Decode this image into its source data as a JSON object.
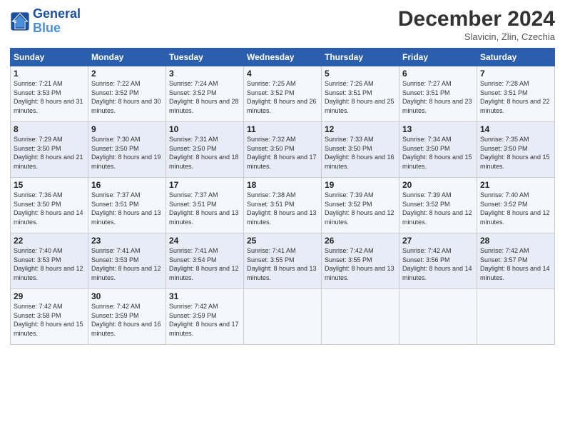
{
  "header": {
    "logo_line1": "General",
    "logo_line2": "Blue",
    "month_title": "December 2024",
    "location": "Slavicin, Zlin, Czechia"
  },
  "weekdays": [
    "Sunday",
    "Monday",
    "Tuesday",
    "Wednesday",
    "Thursday",
    "Friday",
    "Saturday"
  ],
  "weeks": [
    [
      {
        "day": "1",
        "sunrise": "7:21 AM",
        "sunset": "3:53 PM",
        "daylight": "8 hours and 31 minutes."
      },
      {
        "day": "2",
        "sunrise": "7:22 AM",
        "sunset": "3:52 PM",
        "daylight": "8 hours and 30 minutes."
      },
      {
        "day": "3",
        "sunrise": "7:24 AM",
        "sunset": "3:52 PM",
        "daylight": "8 hours and 28 minutes."
      },
      {
        "day": "4",
        "sunrise": "7:25 AM",
        "sunset": "3:52 PM",
        "daylight": "8 hours and 26 minutes."
      },
      {
        "day": "5",
        "sunrise": "7:26 AM",
        "sunset": "3:51 PM",
        "daylight": "8 hours and 25 minutes."
      },
      {
        "day": "6",
        "sunrise": "7:27 AM",
        "sunset": "3:51 PM",
        "daylight": "8 hours and 23 minutes."
      },
      {
        "day": "7",
        "sunrise": "7:28 AM",
        "sunset": "3:51 PM",
        "daylight": "8 hours and 22 minutes."
      }
    ],
    [
      {
        "day": "8",
        "sunrise": "7:29 AM",
        "sunset": "3:50 PM",
        "daylight": "8 hours and 21 minutes."
      },
      {
        "day": "9",
        "sunrise": "7:30 AM",
        "sunset": "3:50 PM",
        "daylight": "8 hours and 19 minutes."
      },
      {
        "day": "10",
        "sunrise": "7:31 AM",
        "sunset": "3:50 PM",
        "daylight": "8 hours and 18 minutes."
      },
      {
        "day": "11",
        "sunrise": "7:32 AM",
        "sunset": "3:50 PM",
        "daylight": "8 hours and 17 minutes."
      },
      {
        "day": "12",
        "sunrise": "7:33 AM",
        "sunset": "3:50 PM",
        "daylight": "8 hours and 16 minutes."
      },
      {
        "day": "13",
        "sunrise": "7:34 AM",
        "sunset": "3:50 PM",
        "daylight": "8 hours and 15 minutes."
      },
      {
        "day": "14",
        "sunrise": "7:35 AM",
        "sunset": "3:50 PM",
        "daylight": "8 hours and 15 minutes."
      }
    ],
    [
      {
        "day": "15",
        "sunrise": "7:36 AM",
        "sunset": "3:50 PM",
        "daylight": "8 hours and 14 minutes."
      },
      {
        "day": "16",
        "sunrise": "7:37 AM",
        "sunset": "3:51 PM",
        "daylight": "8 hours and 13 minutes."
      },
      {
        "day": "17",
        "sunrise": "7:37 AM",
        "sunset": "3:51 PM",
        "daylight": "8 hours and 13 minutes."
      },
      {
        "day": "18",
        "sunrise": "7:38 AM",
        "sunset": "3:51 PM",
        "daylight": "8 hours and 13 minutes."
      },
      {
        "day": "19",
        "sunrise": "7:39 AM",
        "sunset": "3:52 PM",
        "daylight": "8 hours and 12 minutes."
      },
      {
        "day": "20",
        "sunrise": "7:39 AM",
        "sunset": "3:52 PM",
        "daylight": "8 hours and 12 minutes."
      },
      {
        "day": "21",
        "sunrise": "7:40 AM",
        "sunset": "3:52 PM",
        "daylight": "8 hours and 12 minutes."
      }
    ],
    [
      {
        "day": "22",
        "sunrise": "7:40 AM",
        "sunset": "3:53 PM",
        "daylight": "8 hours and 12 minutes."
      },
      {
        "day": "23",
        "sunrise": "7:41 AM",
        "sunset": "3:53 PM",
        "daylight": "8 hours and 12 minutes."
      },
      {
        "day": "24",
        "sunrise": "7:41 AM",
        "sunset": "3:54 PM",
        "daylight": "8 hours and 12 minutes."
      },
      {
        "day": "25",
        "sunrise": "7:41 AM",
        "sunset": "3:55 PM",
        "daylight": "8 hours and 13 minutes."
      },
      {
        "day": "26",
        "sunrise": "7:42 AM",
        "sunset": "3:55 PM",
        "daylight": "8 hours and 13 minutes."
      },
      {
        "day": "27",
        "sunrise": "7:42 AM",
        "sunset": "3:56 PM",
        "daylight": "8 hours and 14 minutes."
      },
      {
        "day": "28",
        "sunrise": "7:42 AM",
        "sunset": "3:57 PM",
        "daylight": "8 hours and 14 minutes."
      }
    ],
    [
      {
        "day": "29",
        "sunrise": "7:42 AM",
        "sunset": "3:58 PM",
        "daylight": "8 hours and 15 minutes."
      },
      {
        "day": "30",
        "sunrise": "7:42 AM",
        "sunset": "3:59 PM",
        "daylight": "8 hours and 16 minutes."
      },
      {
        "day": "31",
        "sunrise": "7:42 AM",
        "sunset": "3:59 PM",
        "daylight": "8 hours and 17 minutes."
      },
      null,
      null,
      null,
      null
    ]
  ],
  "labels": {
    "sunrise": "Sunrise:",
    "sunset": "Sunset:",
    "daylight": "Daylight:"
  }
}
